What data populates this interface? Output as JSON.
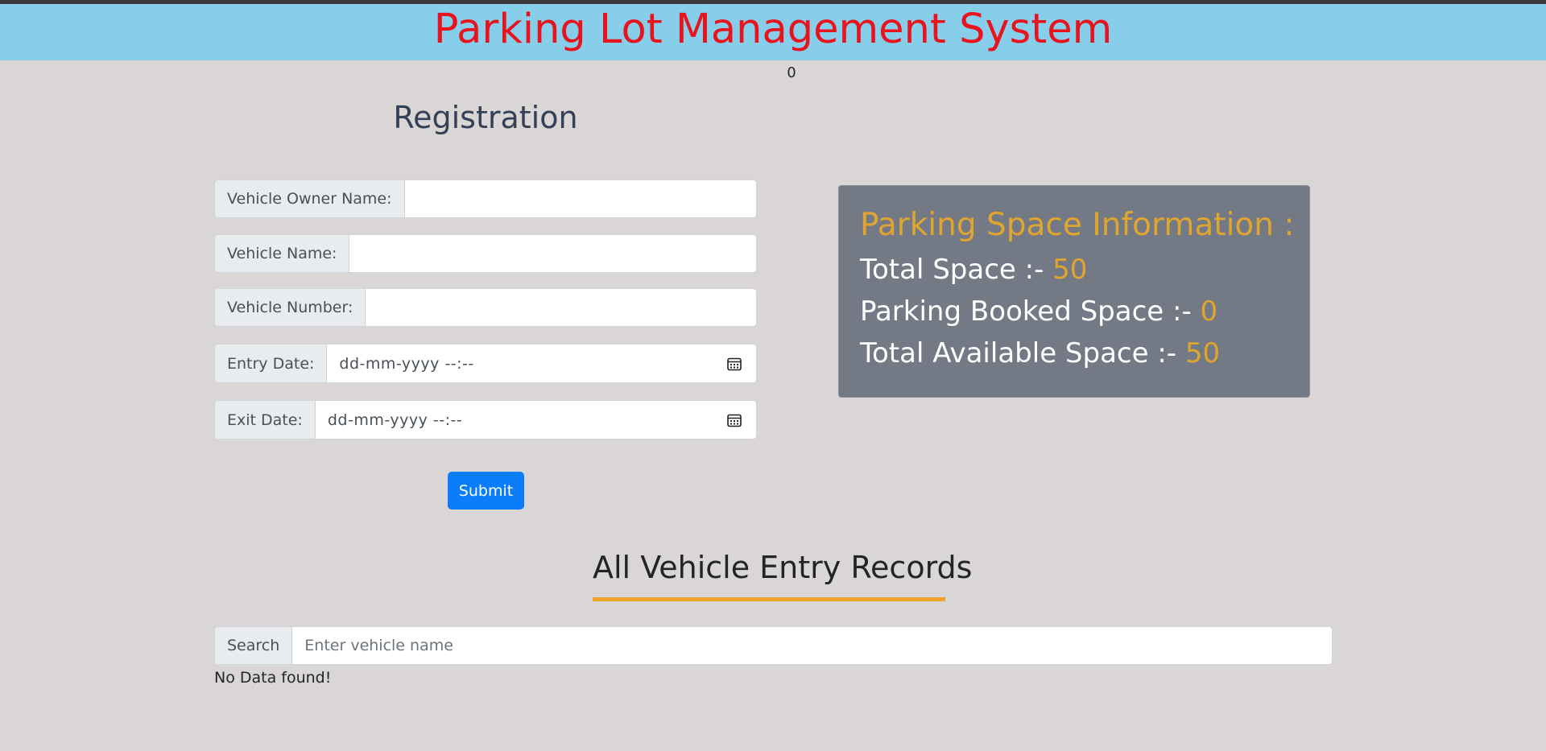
{
  "header": {
    "title": "Parking Lot Management System"
  },
  "counter": "0",
  "registration": {
    "title": "Registration",
    "fields": [
      {
        "label": "Vehicle Owner Name:",
        "value": ""
      },
      {
        "label": "Vehicle Name:",
        "value": ""
      },
      {
        "label": "Vehicle Number:",
        "value": ""
      },
      {
        "label": "Entry Date:",
        "placeholder": "dd-mm-yyyy --:--",
        "icon": "calendar-icon"
      },
      {
        "label": "Exit Date:",
        "placeholder": "dd-mm-yyyy --:--",
        "icon": "calendar-icon"
      }
    ],
    "submit_label": "Submit"
  },
  "info": {
    "title": "Parking Space Information :",
    "total_label": "Total Space :- ",
    "total_value": "50",
    "booked_label": "Parking Booked Space :- ",
    "booked_value": "0",
    "available_label": "Total Available Space :- ",
    "available_value": "50"
  },
  "records": {
    "title": "All Vehicle Entry Records",
    "search_label": "Search",
    "search_placeholder": "Enter vehicle name",
    "empty_text": "No Data found!"
  },
  "colors": {
    "header_bg": "#87ceeb",
    "title_red": "#e8131c",
    "accent_gold": "#e0a52e",
    "submit_blue": "#0b7dfb",
    "underline_orange": "#f0a32a"
  }
}
